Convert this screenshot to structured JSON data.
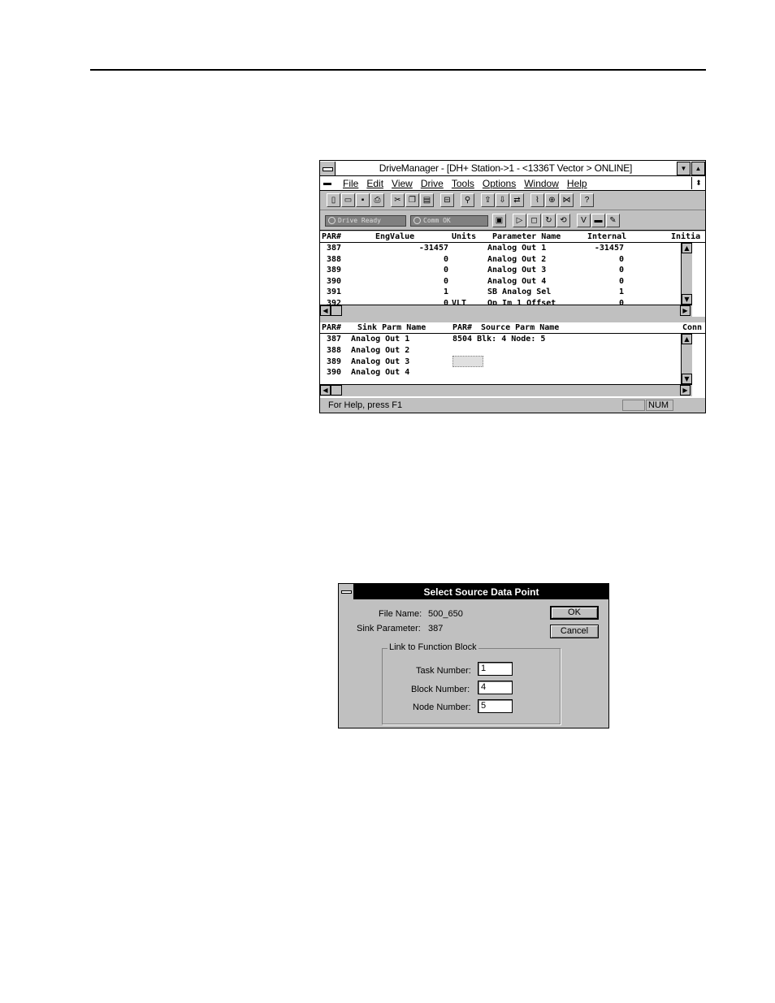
{
  "drivemanager": {
    "title": "DriveManager - [DH+ Station->1 - <1336T Vector    > ONLINE]",
    "menu": [
      "File",
      "Edit",
      "View",
      "Drive",
      "Tools",
      "Options",
      "Window",
      "Help"
    ],
    "status_leds": [
      "Drive Ready",
      "Comm OK"
    ],
    "param_table": {
      "headers": {
        "par": "PAR#",
        "eng": "EngValue",
        "units": "Units",
        "name": "Parameter Name",
        "internal": "Internal",
        "initial": "Initia"
      },
      "rows": [
        {
          "par": "387",
          "eng": "-31457",
          "units": "",
          "name": "Analog Out 1",
          "internal": "-31457"
        },
        {
          "par": "388",
          "eng": "0",
          "units": "",
          "name": "Analog Out 2",
          "internal": "0"
        },
        {
          "par": "389",
          "eng": "0",
          "units": "",
          "name": "Analog Out 3",
          "internal": "0"
        },
        {
          "par": "390",
          "eng": "0",
          "units": "",
          "name": "Analog Out 4",
          "internal": "0"
        },
        {
          "par": "391",
          "eng": "1",
          "units": "",
          "name": "SB Analog Sel",
          "internal": "1"
        },
        {
          "par": "392",
          "eng": "0",
          "units": "VLT",
          "name": "Op Im 1 Offset",
          "internal": "0"
        }
      ]
    },
    "link_table": {
      "headers": {
        "par": "PAR#",
        "sink": "Sink Parm Name",
        "src_par": "PAR#",
        "source": "Source Parm Name",
        "conn": "Conn"
      },
      "rows": [
        {
          "par": "387",
          "sink": "Analog Out 1",
          "source": "8504 Blk: 4 Node: 5"
        },
        {
          "par": "388",
          "sink": "Analog Out 2",
          "source": ""
        },
        {
          "par": "389",
          "sink": "Analog Out 3",
          "source": ""
        },
        {
          "par": "390",
          "sink": "Analog Out 4",
          "source": ""
        }
      ]
    },
    "statusbar": {
      "help": "For Help, press F1",
      "num": "NUM"
    }
  },
  "dialog": {
    "title": "Select Source Data Point",
    "file_name_label": "File Name:",
    "file_name_value": "500_650",
    "sink_param_label": "Sink Parameter:",
    "sink_param_value": "387",
    "ok_label": "OK",
    "cancel_label": "Cancel",
    "group_label": "Link to Function Block",
    "task_label": "Task Number:",
    "task_value": "1",
    "block_label": "Block Number:",
    "block_value": "4",
    "node_label": "Node Number:",
    "node_value": "5"
  }
}
